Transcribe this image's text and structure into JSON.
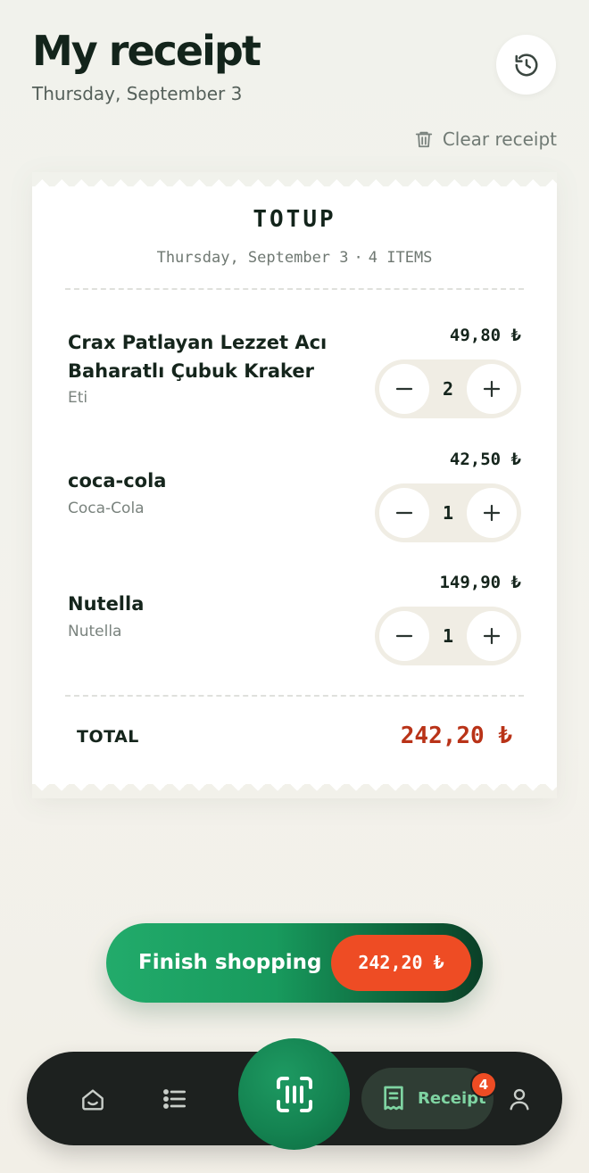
{
  "header": {
    "title": "My receipt",
    "date": "Thursday, September 3",
    "clear_label": "Clear receipt"
  },
  "receipt": {
    "store": "TOTUP",
    "subtitle_date": "Thursday, September 3",
    "subtitle_sep": "·",
    "subtitle_count": "4 ITEMS",
    "items": [
      {
        "name": "Crax Patlayan Lezzet Acı Baharatlı Çubuk Kraker",
        "brand": "Eti",
        "price": "49,80 ₺",
        "qty": "2"
      },
      {
        "name": "coca-cola",
        "brand": "Coca-Cola",
        "price": "42,50 ₺",
        "qty": "1"
      },
      {
        "name": "Nutella",
        "brand": "Nutella",
        "price": "149,90 ₺",
        "qty": "1"
      }
    ],
    "total_label": "TOTAL",
    "total_value": "242,20 ₺"
  },
  "finish": {
    "label": "Finish shopping",
    "amount": "242,20 ₺"
  },
  "nav": {
    "receipt_label": "Receipt",
    "badge_count": "4",
    "items": [
      "home-icon",
      "list-icon",
      "barcode-scan-icon",
      "receipt-icon",
      "user-icon"
    ]
  },
  "colors": {
    "accent_green": "#189a5d",
    "total_red": "#b93318",
    "badge_orange": "#ee4c24",
    "nav_dark": "#1d211f"
  }
}
